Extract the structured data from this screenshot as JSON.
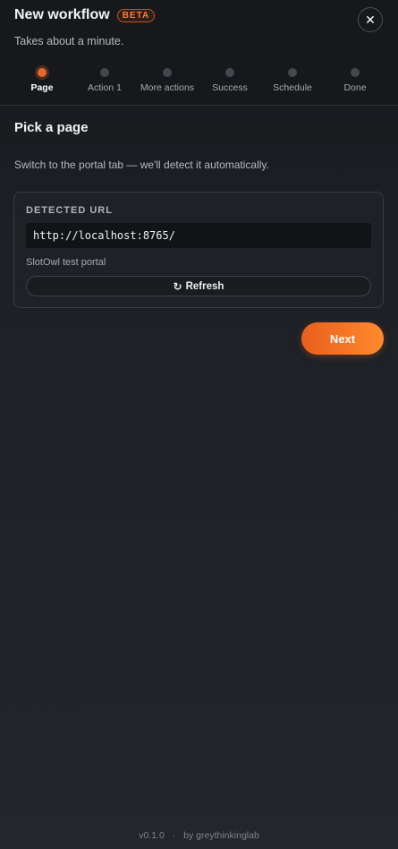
{
  "header": {
    "title": "New workflow",
    "badge": "BETA",
    "subtitle": "Takes about a minute.",
    "close_icon": "close-icon"
  },
  "steps": [
    {
      "label": "Page",
      "active": true
    },
    {
      "label": "Action 1",
      "active": false
    },
    {
      "label": "More actions",
      "active": false
    },
    {
      "label": "Success",
      "active": false
    },
    {
      "label": "Schedule",
      "active": false
    },
    {
      "label": "Done",
      "active": false
    }
  ],
  "main": {
    "section_title": "Pick a page",
    "hint": "Switch to the portal tab — we'll detect it automatically.",
    "card": {
      "label": "DETECTED URL",
      "url": "http://localhost:8765/",
      "page_name": "SlotOwl test portal",
      "refresh_icon": "refresh-icon",
      "refresh_label": "Refresh"
    },
    "next_label": "Next"
  },
  "footer": {
    "version": "v0.1.0",
    "separator": "·",
    "credit": "by greythinkinglab"
  },
  "colors": {
    "accent": "#e8662b",
    "background": "#1f2227"
  }
}
